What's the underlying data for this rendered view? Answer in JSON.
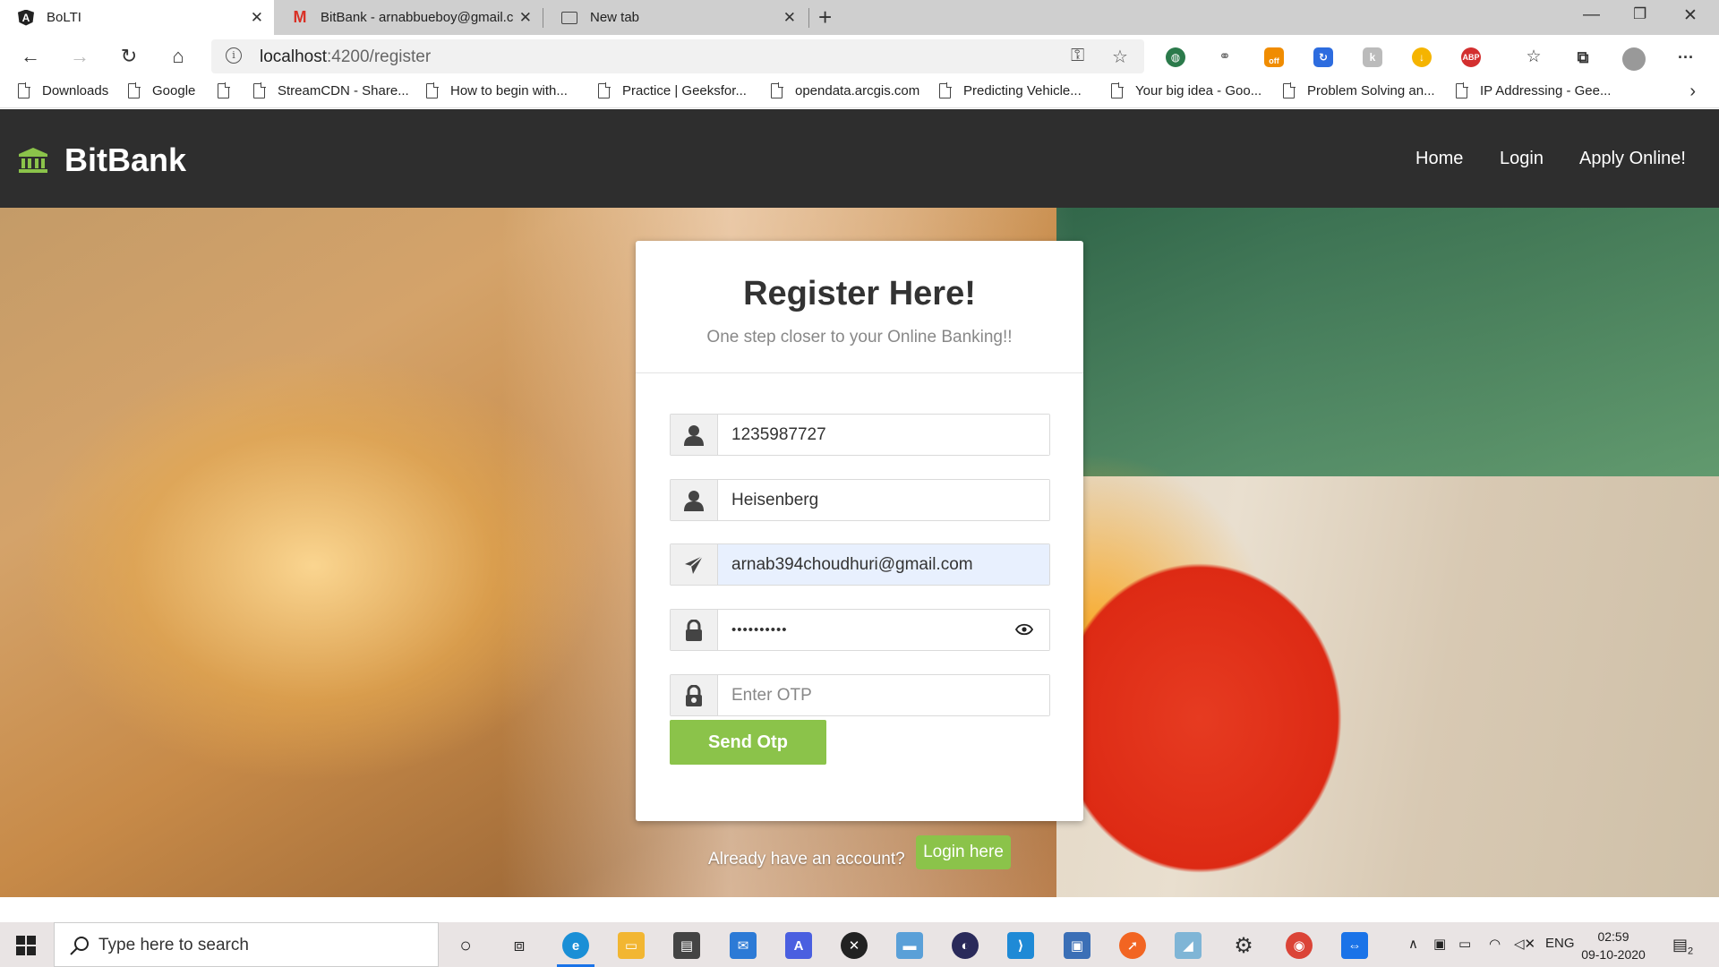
{
  "browser": {
    "tabs": [
      {
        "title": "BoLTI",
        "active": true,
        "icon": "angular-icon"
      },
      {
        "title": "BitBank - arnabbueboy@gmail.c",
        "active": false,
        "icon": "gmail-icon"
      },
      {
        "title": "New tab",
        "active": false,
        "icon": "newtab-icon"
      }
    ],
    "address": {
      "host": "localhost",
      "path": ":4200/register"
    },
    "bookmarks": [
      "Downloads",
      "Google",
      "",
      "StreamCDN - Share...",
      "How to begin with...",
      "Practice | Geeksfor...",
      "opendata.arcgis.com",
      "Predicting Vehicle...",
      "Your big idea - Goo...",
      "Problem Solving an...",
      "IP Addressing - Gee..."
    ]
  },
  "app": {
    "brand": "BitBank",
    "nav": {
      "home": "Home",
      "login": "Login",
      "apply": "Apply Online!"
    }
  },
  "form": {
    "title": "Register Here!",
    "subtitle": "One step closer to your Online Banking!!",
    "account_value": "1235987727",
    "name_value": "Heisenberg",
    "email_value": "arnab394choudhuri@gmail.com",
    "password_value": "••••••••••",
    "otp_placeholder": "Enter OTP",
    "send_otp": "Send Otp",
    "already": "Already have an account?",
    "login_here": "Login here"
  },
  "taskbar": {
    "search_placeholder": "Type here to search",
    "lang": "ENG",
    "time": "02:59",
    "date": "09-10-2020",
    "notifications": "2"
  },
  "colors": {
    "accent": "#8bc34a",
    "navbar": "#2e2e2e",
    "autofill": "#e8f0fe"
  }
}
